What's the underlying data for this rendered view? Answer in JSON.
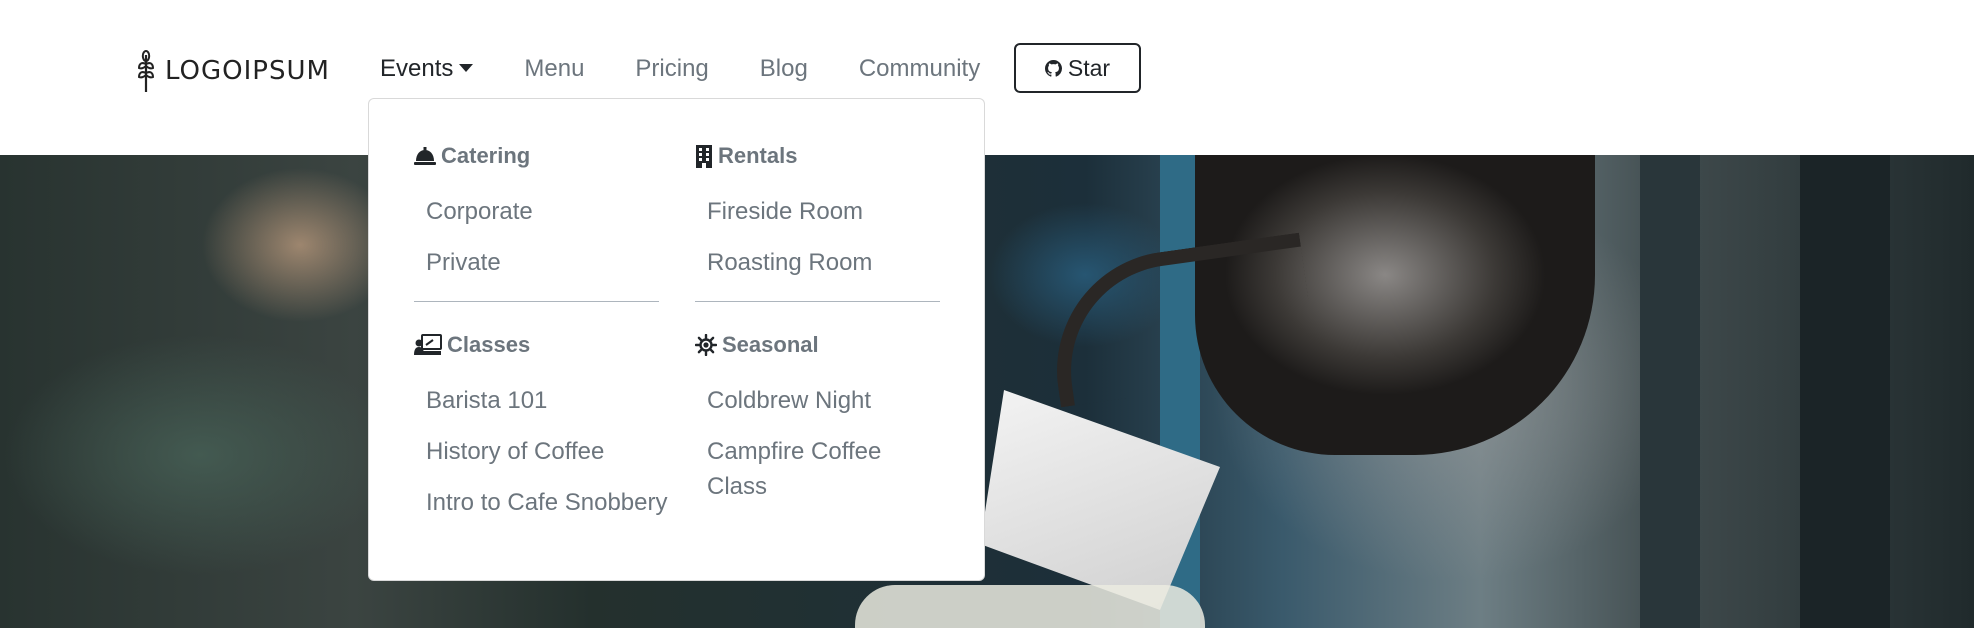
{
  "brand": {
    "name": "LOGOIPSUM",
    "icon": "wheat-icon"
  },
  "nav": {
    "items": [
      {
        "label": "Events",
        "active": true
      },
      {
        "label": "Menu"
      },
      {
        "label": "Pricing"
      },
      {
        "label": "Blog"
      },
      {
        "label": "Community"
      }
    ],
    "star_button": {
      "label": "Star",
      "icon": "github-icon"
    }
  },
  "dropdown": {
    "sections": [
      {
        "title": "Catering",
        "icon": "bell-icon",
        "items": [
          "Corporate",
          "Private"
        ]
      },
      {
        "title": "Rentals",
        "icon": "building-icon",
        "items": [
          "Fireside Room",
          "Roasting Room"
        ]
      },
      {
        "title": "Classes",
        "icon": "presentation-icon",
        "items": [
          "Barista 101",
          "History of Coffee",
          "Intro to Cafe Snobbery"
        ]
      },
      {
        "title": "Seasonal",
        "icon": "sun-icon",
        "items": [
          "Coldbrew Night",
          "Campfire Coffee Class"
        ]
      }
    ]
  },
  "colors": {
    "text": "#212529",
    "muted": "#6c757d",
    "border": "#212529"
  }
}
